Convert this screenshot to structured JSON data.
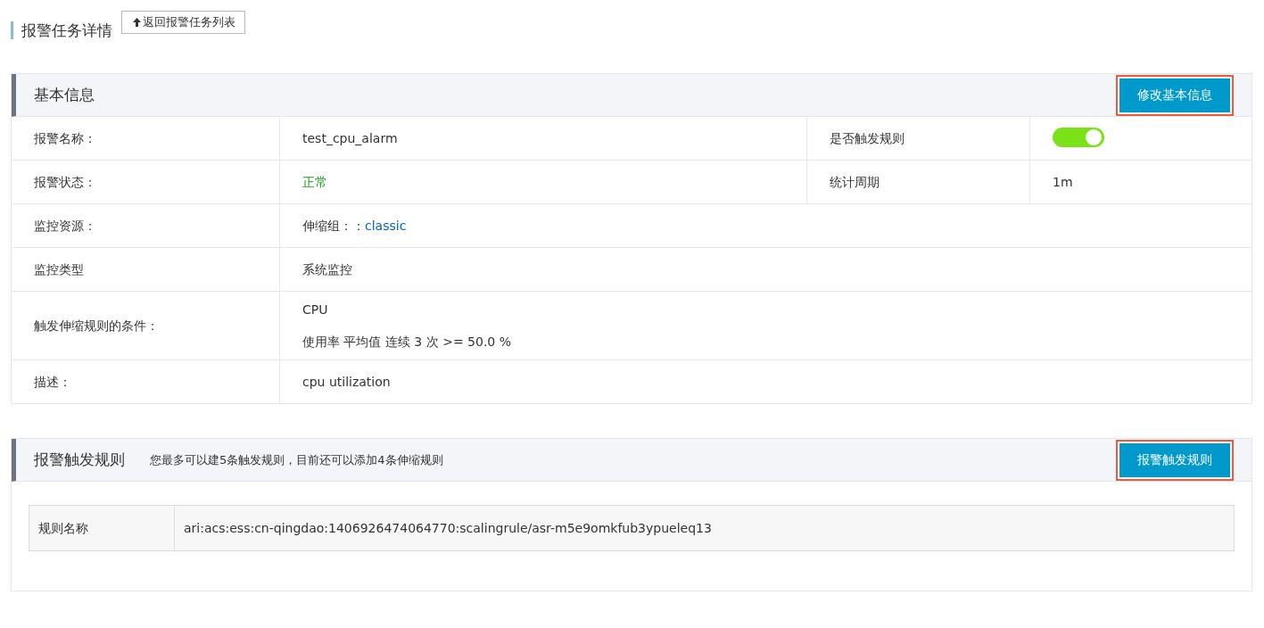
{
  "page": {
    "title": "报警任务详情",
    "back_button": "返回报警任务列表"
  },
  "basic_info": {
    "title": "基本信息",
    "action": "修改基本信息",
    "action_highlighted": true,
    "rows": [
      {
        "label": "报警名称：",
        "value": {
          "kind": "text",
          "text": "test_cpu_alarm"
        },
        "side": {
          "label": "是否触发规则",
          "value": {
            "kind": "toggle",
            "on": true
          }
        }
      },
      {
        "label": "报警状态：",
        "value": {
          "kind": "status",
          "text": "正常"
        },
        "side": {
          "label": "统计周期",
          "value": {
            "kind": "text",
            "text": "1m"
          }
        }
      },
      {
        "label": "监控资源：",
        "value": {
          "kind": "link",
          "prefix": "伸缩组：：",
          "link": "classic"
        }
      },
      {
        "label": "监控类型",
        "value": {
          "kind": "text",
          "text": "系统监控"
        }
      },
      {
        "label": "触发伸缩规则的条件：",
        "value": {
          "kind": "lines",
          "lines": [
            "CPU",
            "使用率 平均值 连续 3 次 >= 50.0 %"
          ]
        }
      },
      {
        "label": "描述：",
        "value": {
          "kind": "text",
          "text": "cpu utilization"
        }
      }
    ]
  },
  "trigger_rules": {
    "title": "报警触发规则",
    "note": "您最多可以建5条触发规则，目前还可以添加4条伸缩规则",
    "action": "报警触发规则",
    "action_highlighted": true,
    "rules": [
      {
        "label": "规则名称",
        "value": "ari:acs:ess:cn-qingdao:1406926474064770:scalingrule/asr-m5e9omkfub3ypueleq13"
      }
    ]
  }
}
